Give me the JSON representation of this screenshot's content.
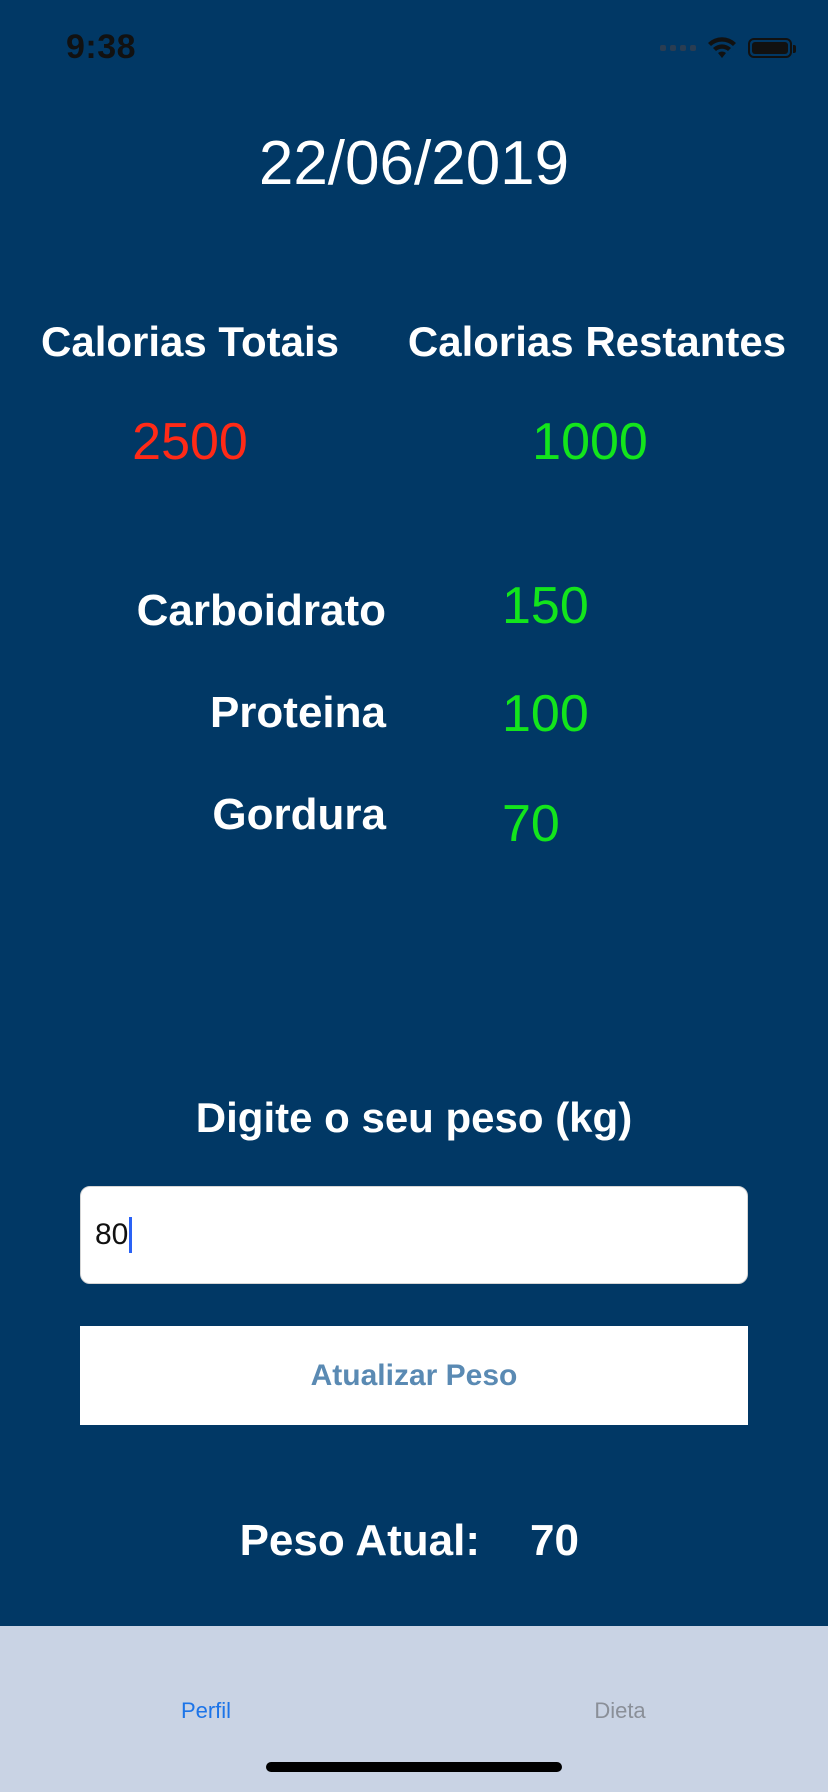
{
  "status_bar": {
    "time": "9:38"
  },
  "date": "22/06/2019",
  "calories": {
    "total_label": "Calorias Totais",
    "total_value": "2500",
    "remaining_label": "Calorias Restantes",
    "remaining_value": "1000",
    "total_color": "#ff2a17",
    "remaining_color": "#13e51c"
  },
  "macros": [
    {
      "label": "Carboidrato",
      "value": "150"
    },
    {
      "label": "Proteina",
      "value": "100"
    },
    {
      "label": "Gordura",
      "value": "70"
    }
  ],
  "weight": {
    "prompt": "Digite o seu peso (kg)",
    "input_value": "80",
    "button_label": "Atualizar Peso",
    "current_label": "Peso Atual:",
    "current_value": "70"
  },
  "tabs": [
    {
      "label": "Perfil",
      "active": true
    },
    {
      "label": "Dieta",
      "active": false
    }
  ],
  "colors": {
    "background": "#013865",
    "tabbar": "#c9d3e4",
    "active_tab": "#1c74e8"
  }
}
